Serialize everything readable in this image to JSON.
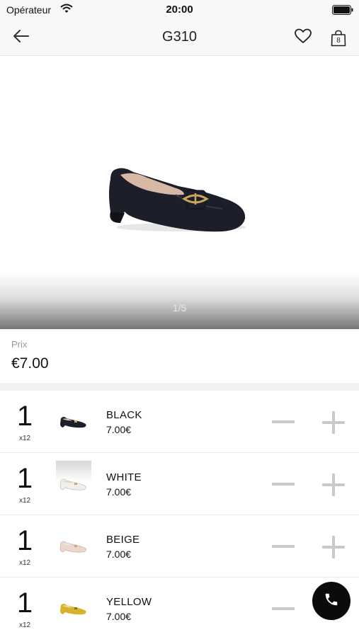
{
  "status_bar": {
    "carrier": "Opérateur",
    "time": "20:00"
  },
  "nav": {
    "title": "G310",
    "bag_count": "8"
  },
  "gallery": {
    "counter": "1/5"
  },
  "price": {
    "label": "Prix",
    "value": "€7.00"
  },
  "variants": [
    {
      "qty": "1",
      "pack": "x12",
      "color": "BLACK",
      "price": "7.00€",
      "shoe_color": "#1c1f2a"
    },
    {
      "qty": "1",
      "pack": "x12",
      "color": "WHITE",
      "price": "7.00€",
      "shoe_color": "#f1efea"
    },
    {
      "qty": "1",
      "pack": "x12",
      "color": "BEIGE",
      "price": "7.00€",
      "shoe_color": "#ead7cf"
    },
    {
      "qty": "1",
      "pack": "x12",
      "color": "YELLOW",
      "price": "7.00€",
      "shoe_color": "#d8b22c"
    }
  ],
  "icons": {
    "back": "arrow-left-icon",
    "favorite": "heart-icon",
    "bag": "shopping-bag-icon",
    "minus": "minus-icon",
    "plus": "plus-icon",
    "call": "phone-icon"
  },
  "colors": {
    "fab_background": "#0b0b0b",
    "control_gray": "#c9c9c9"
  }
}
